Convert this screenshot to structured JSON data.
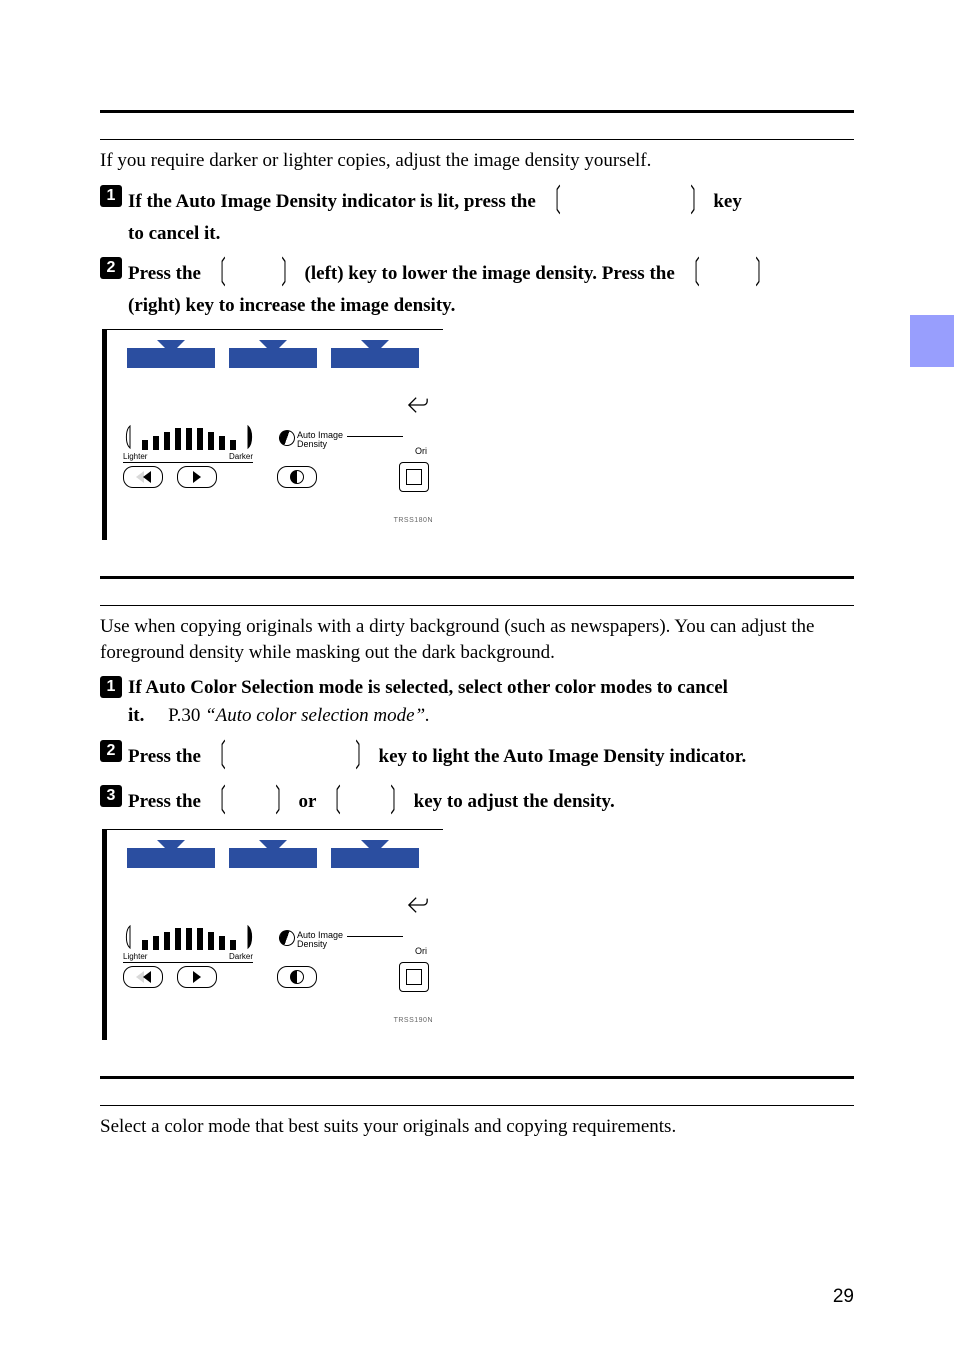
{
  "blocks": {
    "s1": {
      "intro": "If you require darker or lighter copies, adjust the image density yourself.",
      "step1a": "If the Auto Image Density indicator is lit, press the ",
      "step1b": " key",
      "step1c": "to cancel it.",
      "step2a": "Press the ",
      "step2b": " (left) key to lower the image density. Press the ",
      "step2c": "(right) key to increase the image density."
    },
    "s2": {
      "intro": "Use when copying originals with a dirty background (such as newspapers). You can adjust the foreground density while masking out the dark background.",
      "step1a": "If Auto Color Selection mode is selected, select other color modes to cancel",
      "step1b": "it. ",
      "step1ref": "P.30 ",
      "step1it": "“Auto color selection mode”.",
      "step2a": "Press the ",
      "step2b": " key to light the Auto Image Density indicator.",
      "step3a": "Press the ",
      "step3b": " or ",
      "step3c": " key to adjust the density."
    },
    "s3": {
      "intro": "Select a color mode that best suits your originals and copying requirements."
    }
  },
  "illus": {
    "lighter": "Lighter",
    "darker": "Darker",
    "autoImg": "Auto Image",
    "density": "Density",
    "ori": "Ori",
    "code1": "TRSS180N",
    "code2": "TRSS190N"
  },
  "page": "29"
}
